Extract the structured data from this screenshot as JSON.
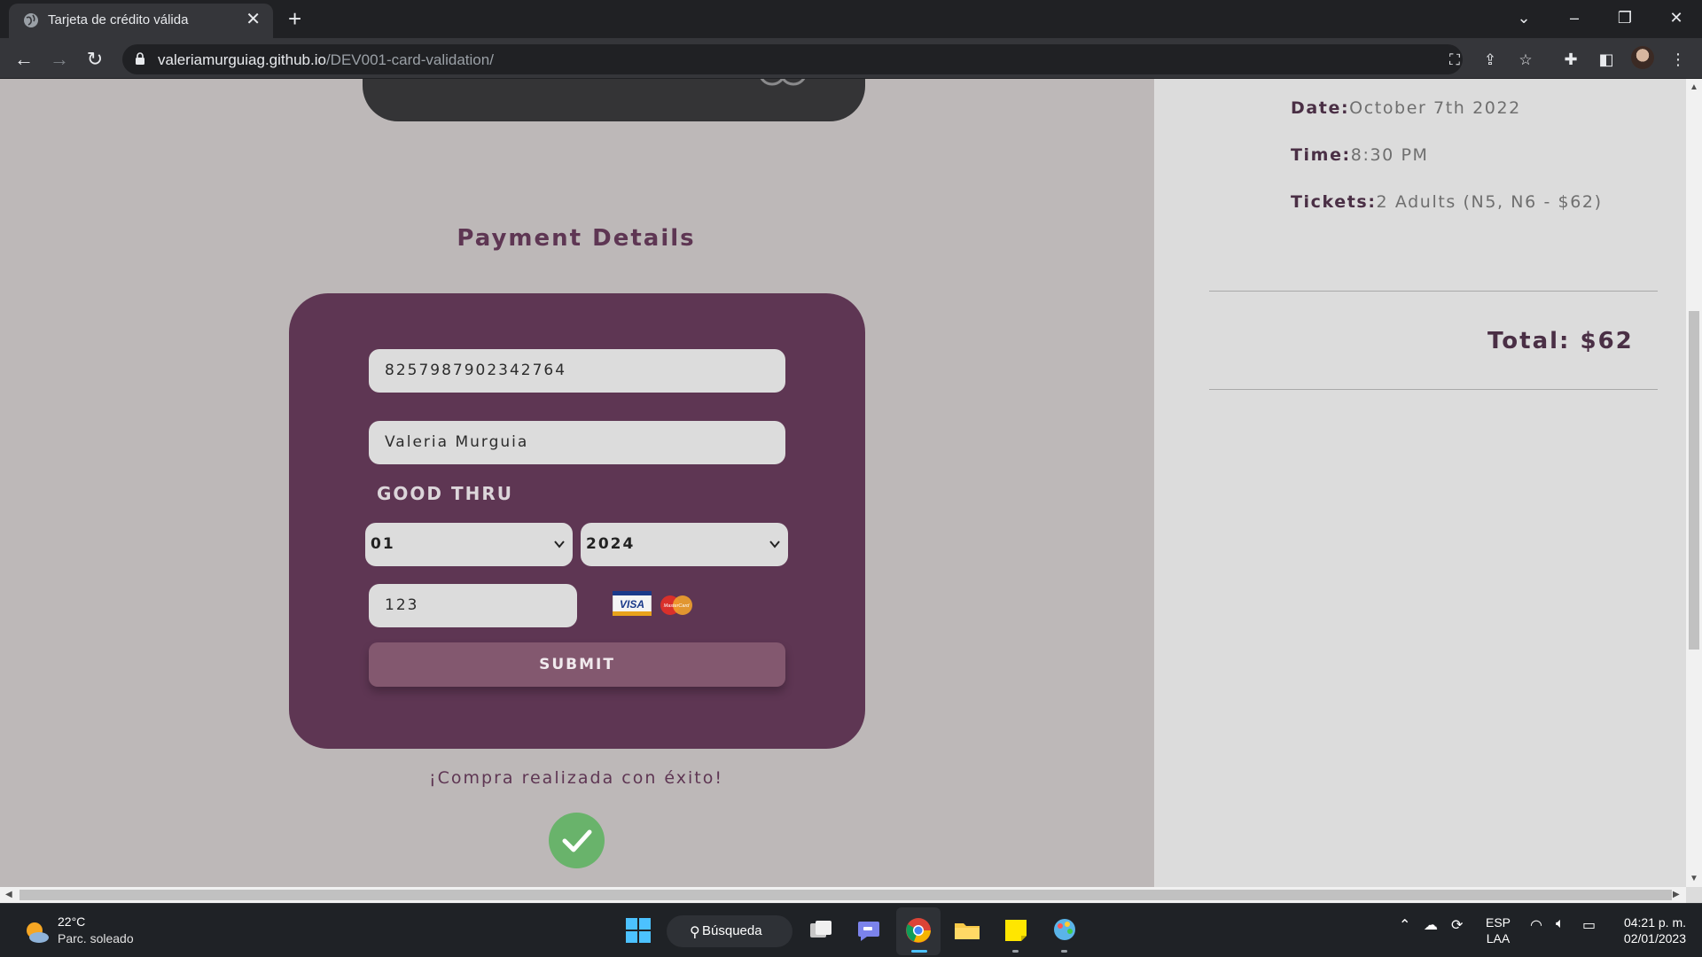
{
  "browser": {
    "tab_title": "Tarjeta de crédito válida",
    "url_host": "valeriamurguiag.github.io",
    "url_path": "/DEV001-card-validation/"
  },
  "page": {
    "payment_title": "Payment Details",
    "card_number": "8257987902342764",
    "card_name": "Valeria Murguia",
    "good_thru_label": "GOOD THRU",
    "month_selected": "01",
    "year_selected": "2024",
    "cvv": "123",
    "card_brands": [
      "VISA",
      "MasterCard"
    ],
    "submit_label": "SUBMIT",
    "success_message": "¡Compra realizada con éxito!"
  },
  "summary": {
    "date_label": "Date:",
    "date_value": "October 7th 2022",
    "time_label": "Time:",
    "time_value": "8:30 PM",
    "tickets_label": "Tickets:",
    "tickets_value": "2 Adults (N5, N6 - $62)",
    "total": "Total: $62"
  },
  "taskbar": {
    "weather_temp": "22°C",
    "weather_desc": "Parc. soleado",
    "search_label": "Búsqueda",
    "lang_top": "ESP",
    "lang_bottom": "LAA",
    "time": "04:21 p. m.",
    "date": "02/01/2023"
  },
  "colors": {
    "page_bg": "#bdb8b8",
    "card_bg": "#5e3653",
    "submit_bg": "#83586f",
    "success_check": "#69b36b"
  }
}
